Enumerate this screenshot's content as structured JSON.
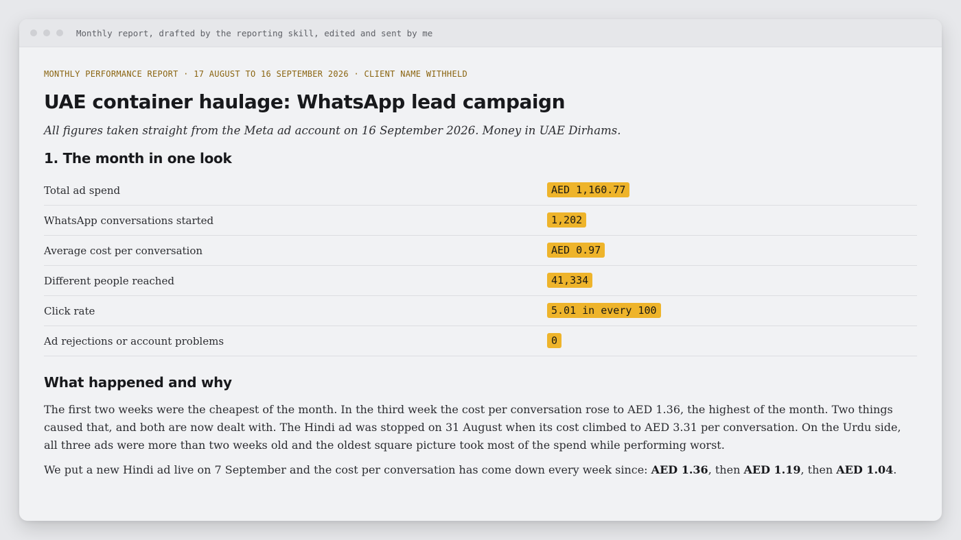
{
  "window": {
    "title": "Monthly report, drafted by the reporting skill, edited and sent by me"
  },
  "report": {
    "eyebrow": "MONTHLY PERFORMANCE REPORT · 17 AUGUST TO 16 SEPTEMBER 2026 · CLIENT NAME WITHHELD",
    "title": "UAE container haulage: WhatsApp lead campaign",
    "subtitle": "All figures taken straight from the Meta ad account on 16 September 2026. Money in UAE Dirhams.",
    "section1_heading": "1. The month in one look",
    "kpis": [
      {
        "label": "Total ad spend",
        "value": "AED 1,160.77"
      },
      {
        "label": "WhatsApp conversations started",
        "value": "1,202"
      },
      {
        "label": "Average cost per conversation",
        "value": "AED 0.97"
      },
      {
        "label": "Different people reached",
        "value": "41,334"
      },
      {
        "label": "Click rate",
        "value": "5.01 in every 100"
      },
      {
        "label": "Ad rejections or account problems",
        "value": "0"
      }
    ],
    "section2_heading": "What happened and why",
    "paragraph1": "The first two weeks were the cheapest of the month. In the third week the cost per conversation rose to AED 1.36, the highest of the month. Two things caused that, and both are now dealt with. The Hindi ad was stopped on 31 August when its cost climbed to AED 3.31 per conversation. On the Urdu side, all three ads were more than two weeks old and the oldest square picture took most of the spend while performing worst.",
    "paragraph2": {
      "intro": "We put a new Hindi ad live on 7 September and the cost per conversation has come down every week since: ",
      "value1": "AED 1.36",
      "sep1": ", then ",
      "value2": "AED 1.19",
      "sep2": ", then ",
      "value3": "AED 1.04",
      "end": "."
    }
  },
  "colors": {
    "accent_highlight": "#eeb42b",
    "eyebrow": "#8a6410",
    "background": "#f1f2f4"
  }
}
